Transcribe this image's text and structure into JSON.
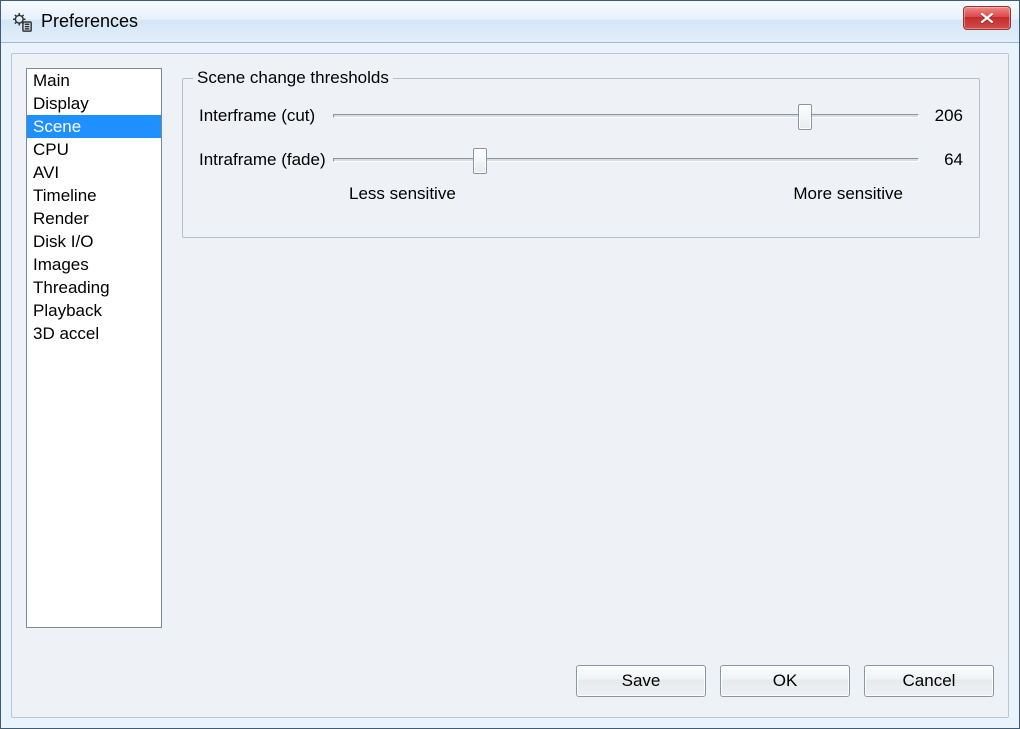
{
  "window": {
    "title": "Preferences"
  },
  "sidebar": {
    "items": [
      {
        "label": "Main"
      },
      {
        "label": "Display"
      },
      {
        "label": "Scene",
        "selected": true
      },
      {
        "label": "CPU"
      },
      {
        "label": "AVI"
      },
      {
        "label": "Timeline"
      },
      {
        "label": "Render"
      },
      {
        "label": "Disk I/O"
      },
      {
        "label": "Images"
      },
      {
        "label": "Threading"
      },
      {
        "label": "Playback"
      },
      {
        "label": "3D accel"
      }
    ]
  },
  "group": {
    "legend": "Scene change thresholds",
    "sliders": [
      {
        "label": "Interframe (cut)",
        "value": 206,
        "max": 256
      },
      {
        "label": "Intraframe (fade)",
        "value": 64,
        "max": 256
      }
    ],
    "hint_left": "Less sensitive",
    "hint_right": "More sensitive"
  },
  "buttons": {
    "save": "Save",
    "ok": "OK",
    "cancel": "Cancel"
  }
}
